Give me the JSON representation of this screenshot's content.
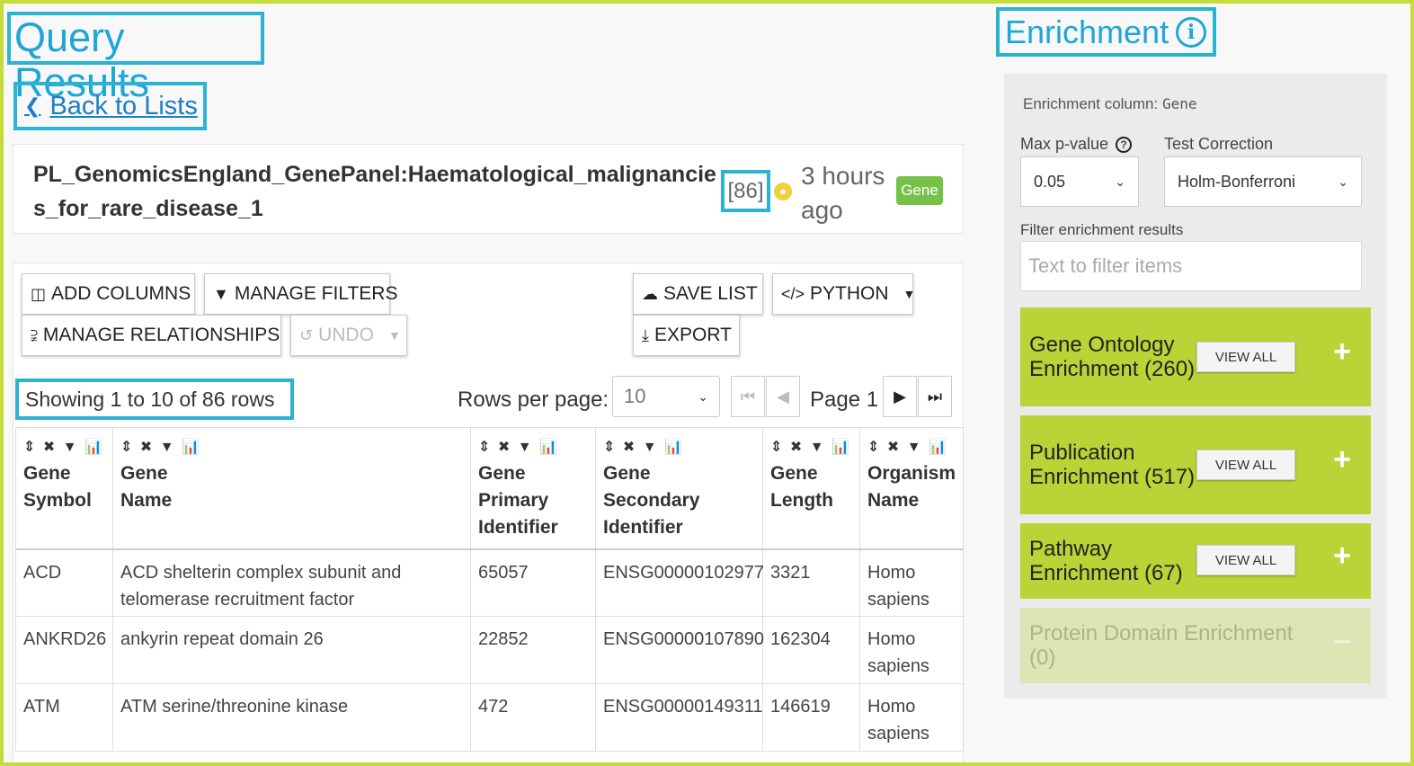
{
  "query_title": "Query Results",
  "enrichment_title": "Enrichment",
  "back_label": "Back to Lists",
  "list": {
    "name": "PL_GenomicsEngland_GenePanel:Haematological_malignancies_for_rare_disease_1",
    "count": "[86]",
    "time_ago": "3 hours ago",
    "type": "Gene"
  },
  "toolbar": {
    "add_columns": "ADD COLUMNS",
    "manage_filters": "MANAGE FILTERS",
    "manage_relationships": "MANAGE RELATIONSHIPS",
    "undo": "UNDO",
    "save_list": "SAVE LIST",
    "python": "PYTHON",
    "export": "EXPORT"
  },
  "pagination": {
    "showing": "Showing 1 to 10 of 86 rows",
    "rows_per_page_label": "Rows per page:",
    "rows_per_page": "10",
    "page": "Page 1"
  },
  "table": {
    "icons": "⇕ ✖ ▼ 📊",
    "headers": [
      {
        "line1": "Gene",
        "line2": "Symbol",
        "line3": ""
      },
      {
        "line1": "Gene",
        "line2": "Name",
        "line3": ""
      },
      {
        "line1": "Gene",
        "line2": "Primary",
        "line3": "Identifier"
      },
      {
        "line1": "Gene",
        "line2": "Secondary",
        "line3": "Identifier"
      },
      {
        "line1": "Gene",
        "line2": "Length",
        "line3": ""
      },
      {
        "line1": "Organism",
        "line2": "Name",
        "line3": ""
      }
    ],
    "rows": [
      [
        "ACD",
        "ACD shelterin complex subunit and telomerase recruitment factor",
        "65057",
        "ENSG00000102977",
        "3321",
        "Homo sapiens"
      ],
      [
        "ANKRD26",
        "ankyrin repeat domain 26",
        "22852",
        "ENSG00000107890",
        "162304",
        "Homo sapiens"
      ],
      [
        "ATM",
        "ATM serine/threonine kinase",
        "472",
        "ENSG00000149311",
        "146619",
        "Homo sapiens"
      ]
    ]
  },
  "enrichment": {
    "column_label": "Enrichment column:",
    "column_value": "Gene",
    "max_p_label": "Max p-value",
    "max_p_value": "0.05",
    "test_correction_label": "Test Correction",
    "test_correction_value": "Holm-Bonferroni",
    "filter_label": "Filter enrichment results",
    "filter_placeholder": "Text to filter items",
    "view_all": "VIEW ALL",
    "widgets": [
      {
        "title": "Gene Ontology Enrichment (260)"
      },
      {
        "title": "Publication Enrichment (517)"
      },
      {
        "title": "Pathway Enrichment (67)"
      },
      {
        "title": "Protein Domain Enrichment (0)"
      }
    ]
  },
  "colors": {
    "frame": "#c6dc3b",
    "highlight": "#2bb3d2",
    "accent_blue": "#1ea6d6",
    "widget_green": "#bcd337",
    "badge_green": "#77c149"
  }
}
